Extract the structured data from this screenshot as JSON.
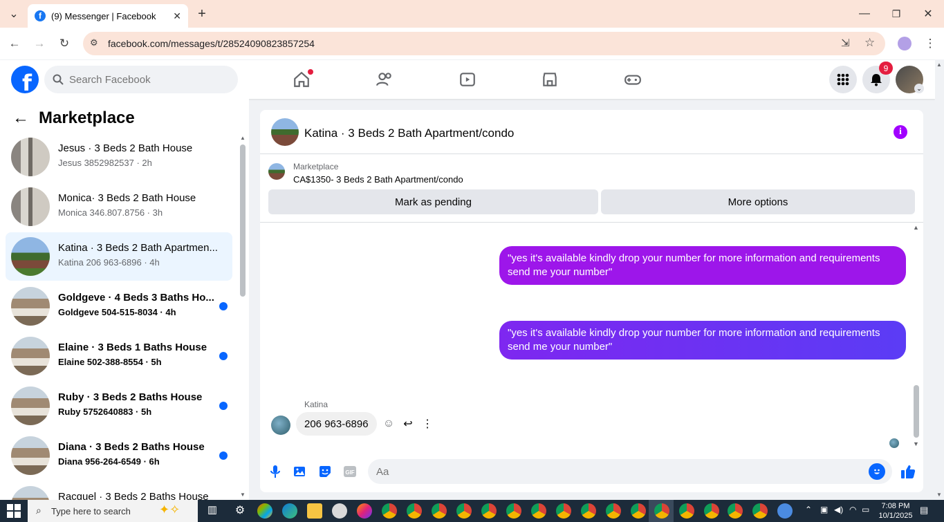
{
  "browser": {
    "tab_title": "(9) Messenger | Facebook",
    "url": "facebook.com/messages/t/28524090823857254"
  },
  "header": {
    "search_placeholder": "Search Facebook",
    "notifications_count": "9"
  },
  "sidebar": {
    "title": "Marketplace",
    "conversations": [
      {
        "name": "Jesus · 3 Beds 2 Bath House",
        "sub": "Jesus 3852982537 · 2h",
        "unread": false,
        "active": false,
        "thumb": "room"
      },
      {
        "name": "Monica· 3 Beds 2 Bath House",
        "sub": "Monica 346.807.8756 · 3h",
        "unread": false,
        "active": false,
        "thumb": "room"
      },
      {
        "name": "Katina · 3 Beds 2 Bath Apartmen...",
        "sub": "Katina 206 963-6896 · 4h",
        "unread": false,
        "active": true,
        "thumb": "apt"
      },
      {
        "name": "Goldgeve · 4 Beds 3 Baths Ho...",
        "sub": "Goldgeve 504-515-8034 · 4h",
        "unread": true,
        "active": false,
        "thumb": "house"
      },
      {
        "name": "Elaine · 3 Beds 1 Baths House",
        "sub": "Elaine 502-388-8554 · 5h",
        "unread": true,
        "active": false,
        "thumb": "house"
      },
      {
        "name": "Ruby · 3 Beds 2 Baths House",
        "sub": "Ruby 5752640883 · 5h",
        "unread": true,
        "active": false,
        "thumb": "house"
      },
      {
        "name": "Diana · 3 Beds 2 Baths House",
        "sub": "Diana 956-264-6549 · 6h",
        "unread": true,
        "active": false,
        "thumb": "house"
      },
      {
        "name": "Racquel · 3 Beds 2 Baths House",
        "sub": "",
        "unread": false,
        "active": false,
        "thumb": "house"
      }
    ]
  },
  "chat": {
    "title": "Katina · 3 Beds 2 Bath Apartment/condo",
    "marketplace_label": "Marketplace",
    "listing": "CA$1350- 3 Beds 2 Bath Apartment/condo",
    "mark_pending": "Mark as pending",
    "more_options": "More options",
    "messages": [
      {
        "from": "me",
        "text": "\"yes it's available kindly drop your number for more information and requirements send me your number\""
      },
      {
        "from": "me",
        "text": "\"yes it's available kindly drop your number for more information and requirements send me your number\""
      }
    ],
    "reply_sender": "Katina",
    "reply_text": "206 963-6896",
    "composer_placeholder": "Aa"
  },
  "taskbar": {
    "search_placeholder": "Type here to search",
    "time": "7:08 PM",
    "date": "10/1/2025"
  },
  "colors": {
    "fb_blue": "#0866ff",
    "bubble1": "#9d16ea",
    "bubble2": "#7b2ff7",
    "info_icon": "#a100ff"
  }
}
